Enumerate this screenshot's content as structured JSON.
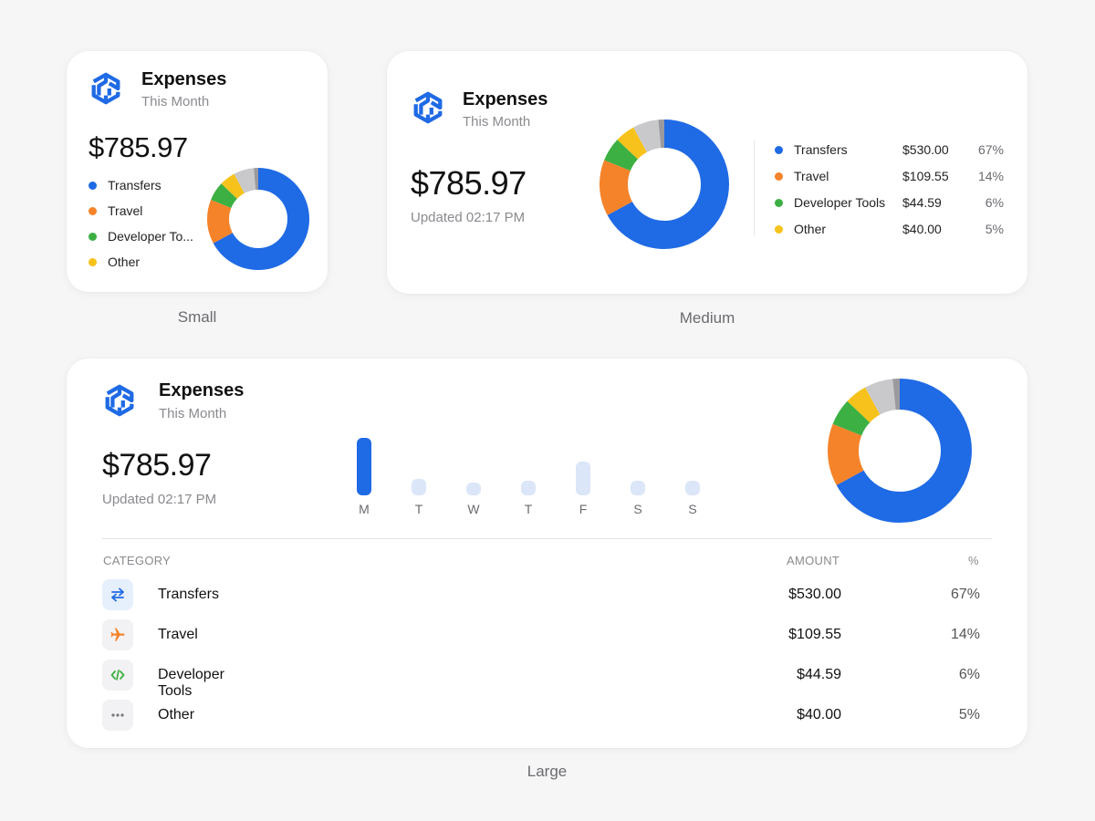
{
  "colors": {
    "blue": "#1f6ae5",
    "orange": "#f5832a",
    "green": "#3cb043",
    "yellow": "#f7c21b",
    "gray": "#c9c9cc",
    "darkgray": "#9a9a9e"
  },
  "widget": {
    "title": "Expenses",
    "subtitle": "This Month",
    "total": "$785.97",
    "updated": "Updated 02:17 PM"
  },
  "captions": {
    "small": "Small",
    "medium": "Medium",
    "large": "Large"
  },
  "small": {
    "legend": [
      "Transfers",
      "Travel",
      "Developer To...",
      "Other"
    ]
  },
  "categories": [
    {
      "name": "Transfers",
      "amount": "$530.00",
      "pct": "67%",
      "share": 67,
      "color": "#1f6ae5",
      "icon": "transfer-arrows-icon"
    },
    {
      "name": "Travel",
      "amount": "$109.55",
      "pct": "14%",
      "share": 14,
      "color": "#f5832a",
      "icon": "airplane-icon"
    },
    {
      "name": "Developer Tools",
      "amount": "$44.59",
      "pct": "6%",
      "share": 6,
      "color": "#3cb043",
      "icon": "code-brackets-icon"
    },
    {
      "name": "Other",
      "amount": "$40.00",
      "pct": "5%",
      "share": 5,
      "color": "#f7c21b",
      "icon": "ellipsis-icon"
    }
  ],
  "remainder_share": 8,
  "weekly": {
    "days": [
      "M",
      "T",
      "W",
      "T",
      "F",
      "S",
      "S"
    ],
    "levels": [
      1.0,
      0.28,
      0.2,
      0.26,
      0.58,
      0.26,
      0.26
    ],
    "active_index": 0
  },
  "table": {
    "col_category": "CATEGORY",
    "col_amount": "AMOUNT",
    "col_pct": "%"
  }
}
